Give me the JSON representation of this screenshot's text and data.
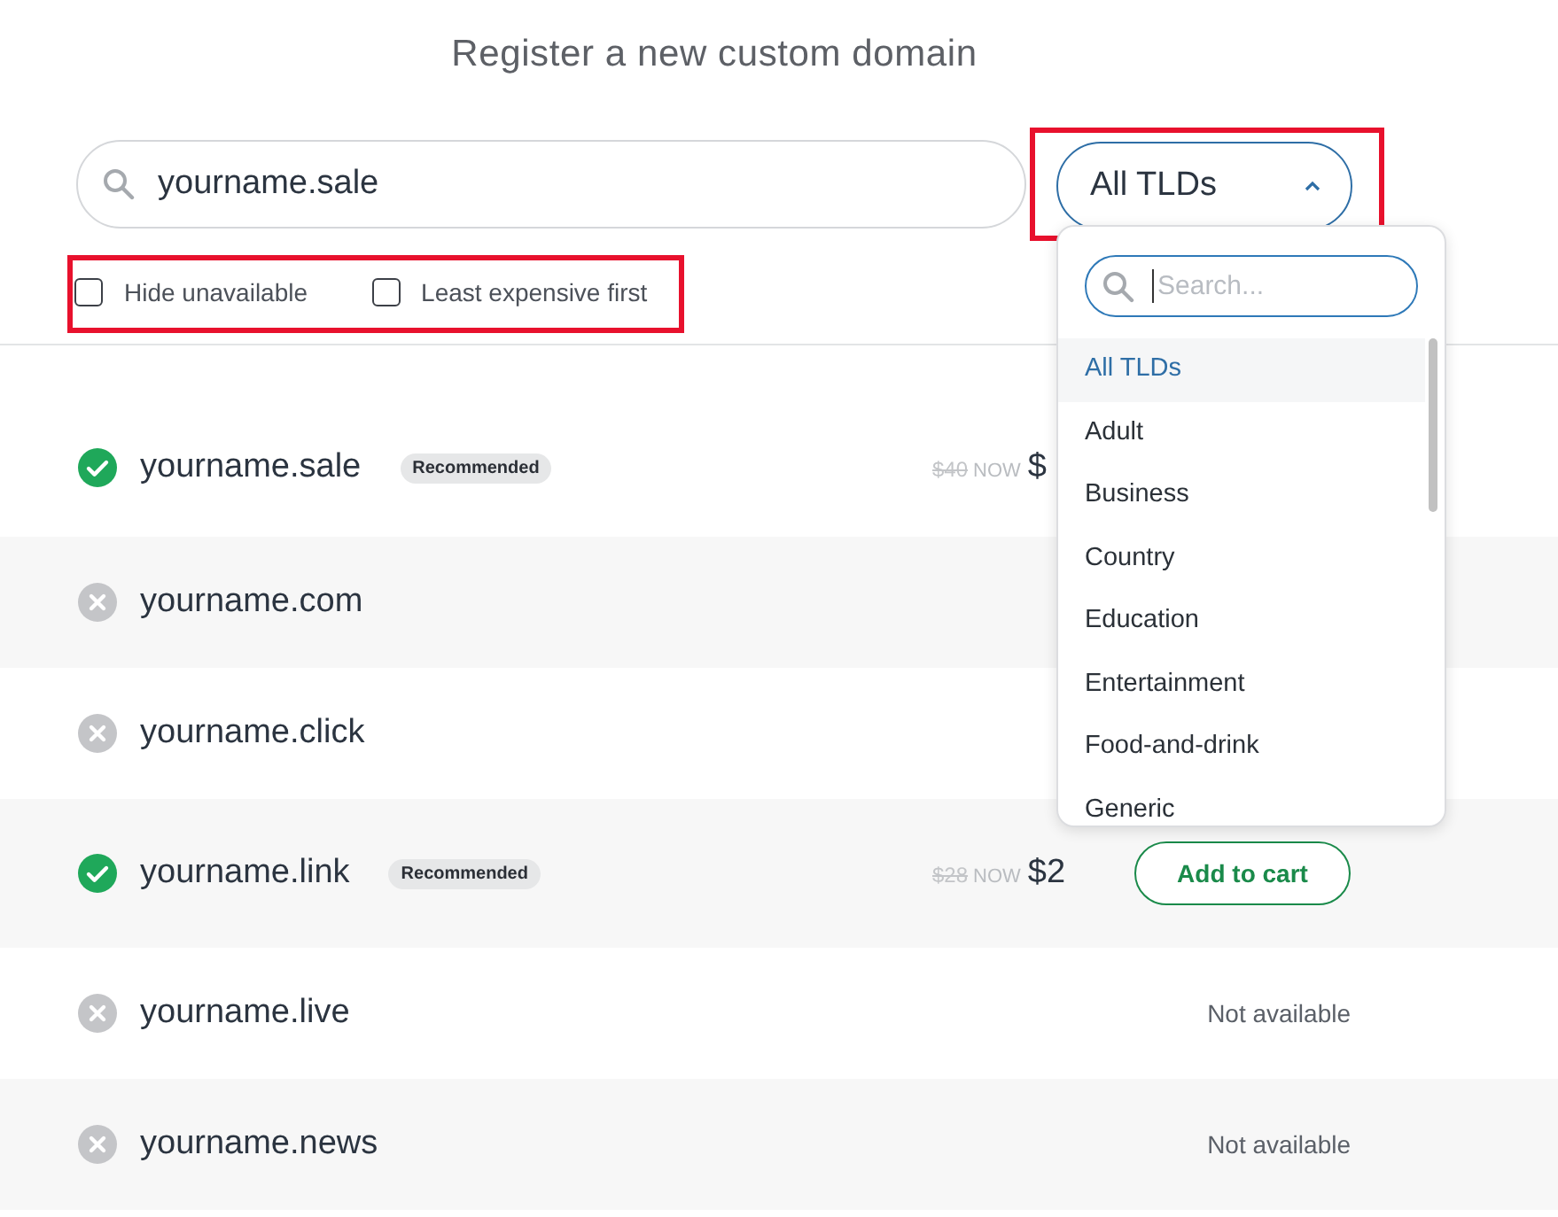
{
  "title": "Register a new custom domain",
  "search": {
    "value": "yourname.sale"
  },
  "tld_select": {
    "value": "All TLDs",
    "expanded": true,
    "highlighted": true
  },
  "filters_highlighted": true,
  "filters": [
    {
      "label": "Hide unavailable",
      "checked": false
    },
    {
      "label": "Least expensive first",
      "checked": false
    }
  ],
  "results": [
    {
      "domain": "yourname.sale",
      "available": true,
      "badge": "Recommended",
      "old_price": "$40",
      "now_label": "NOW",
      "price": "$"
    },
    {
      "domain": "yourname.com",
      "available": false
    },
    {
      "domain": "yourname.click",
      "available": false
    },
    {
      "domain": "yourname.link",
      "available": true,
      "badge": "Recommended",
      "old_price": "$28",
      "now_label": "NOW",
      "price": "$2",
      "action": "Add to cart"
    },
    {
      "domain": "yourname.live",
      "available": false,
      "status": "Not available"
    },
    {
      "domain": "yourname.news",
      "available": false,
      "status": "Not available"
    }
  ],
  "tld_menu": {
    "placeholder": "Search...",
    "items": [
      {
        "label": "All TLDs",
        "selected": true
      },
      {
        "label": "Adult",
        "selected": false
      },
      {
        "label": "Business",
        "selected": false
      },
      {
        "label": "Country",
        "selected": false
      },
      {
        "label": "Education",
        "selected": false
      },
      {
        "label": "Entertainment",
        "selected": false
      },
      {
        "label": "Food-and-drink",
        "selected": false
      },
      {
        "label": "Generic",
        "selected": false
      }
    ]
  }
}
